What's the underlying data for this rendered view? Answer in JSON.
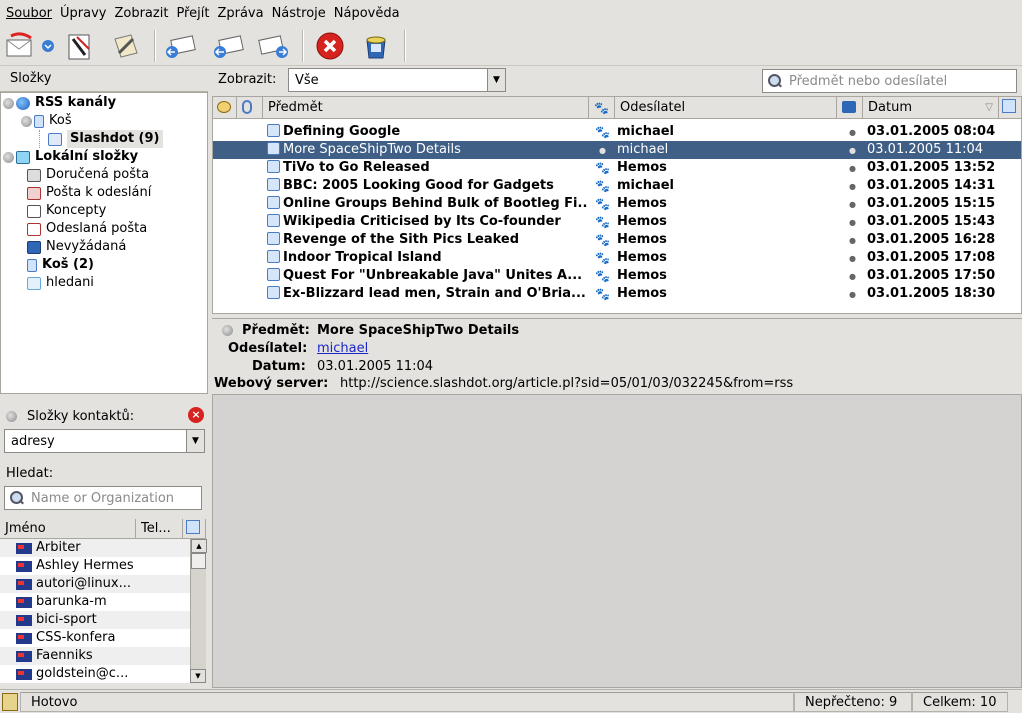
{
  "menubar": {
    "items": [
      {
        "label": "Soubor"
      },
      {
        "label": "Úpravy"
      },
      {
        "label": "Zobrazit"
      },
      {
        "label": "Přejít"
      },
      {
        "label": "Zpráva"
      },
      {
        "label": "Nástroje"
      },
      {
        "label": "Nápověda"
      }
    ]
  },
  "toolbar": {
    "buttons": [
      "get-mail",
      "dropdown",
      "compose",
      "address-book",
      "reply",
      "reply-all",
      "forward",
      "delete",
      "junk"
    ]
  },
  "folders": {
    "header": "Složky",
    "tree": [
      {
        "label": "RSS kanály",
        "bold": true
      },
      {
        "label": "Koš",
        "bold": false
      },
      {
        "label": "Slashdot (9)",
        "bold": true
      },
      {
        "label": "Lokální složky",
        "bold": true
      },
      {
        "label": "Doručená pošta",
        "bold": false
      },
      {
        "label": "Pošta k odeslání",
        "bold": false
      },
      {
        "label": "Koncepty",
        "bold": false
      },
      {
        "label": "Odeslaná pošta",
        "bold": false
      },
      {
        "label": "Nevyžádaná",
        "bold": false
      },
      {
        "label": "Koš (2)",
        "bold": true
      },
      {
        "label": "hledani",
        "bold": false
      }
    ]
  },
  "contacts": {
    "title": "Složky kontaktů:",
    "addressbook": "adresy",
    "search_label": "Hledat:",
    "search_placeholder": "Name or Organization",
    "col_name": "Jméno",
    "col_tel": "Tel...",
    "items": [
      "Arbiter",
      "Ashley Hermes",
      "autori@linux...",
      "barunka-m",
      "bici-sport",
      "CSS-konfera",
      "Faenniks",
      "goldstein@c..."
    ]
  },
  "filter": {
    "label": "Zobrazit:",
    "value": "Vše",
    "search_placeholder": "Předmět nebo odesílatel"
  },
  "messages": {
    "col_subject": "Předmět",
    "col_sender": "Odesílatel",
    "col_date": "Datum",
    "rows": [
      {
        "subject": "Defining Google",
        "sender": "michael",
        "date": "03.01.2005 08:04"
      },
      {
        "subject": "More SpaceShipTwo Details",
        "sender": "michael",
        "date": "03.01.2005 11:04"
      },
      {
        "subject": "TiVo to Go Released",
        "sender": "Hemos",
        "date": "03.01.2005 13:52"
      },
      {
        "subject": "BBC:  2005 Looking Good for Gadgets",
        "sender": "michael",
        "date": "03.01.2005 14:31"
      },
      {
        "subject": "Online Groups Behind Bulk of Bootleg Fi...",
        "sender": "Hemos",
        "date": "03.01.2005 15:15"
      },
      {
        "subject": "Wikipedia Criticised by Its Co-founder",
        "sender": "Hemos",
        "date": "03.01.2005 15:43"
      },
      {
        "subject": "Revenge of the Sith Pics Leaked",
        "sender": "Hemos",
        "date": "03.01.2005 16:28"
      },
      {
        "subject": "Indoor Tropical Island",
        "sender": "Hemos",
        "date": "03.01.2005 17:08"
      },
      {
        "subject": "Quest For \"Unbreakable Java\" Unites A...",
        "sender": "Hemos",
        "date": "03.01.2005 17:50"
      },
      {
        "subject": "Ex-Blizzard lead men, Strain and O'Bria...",
        "sender": "Hemos",
        "date": "03.01.2005 18:30"
      }
    ]
  },
  "preview": {
    "subject_label": "Předmět:",
    "subject": "More SpaceShipTwo Details",
    "sender_label": "Odesílatel:",
    "sender": "michael",
    "date_label": "Datum:",
    "date": "03.01.2005 11:04",
    "server_label": "Webový server:",
    "server": "http://science.slashdot.org/article.pl?sid=05/01/03/032245&from=rss"
  },
  "status": {
    "text": "Hotovo",
    "unread": "Nepřečteno: 9",
    "total": "Celkem: 10"
  },
  "colors": {
    "selected_row": "#3f5f86",
    "link": "#1a27c9",
    "window_bg": "#e4e2de"
  }
}
